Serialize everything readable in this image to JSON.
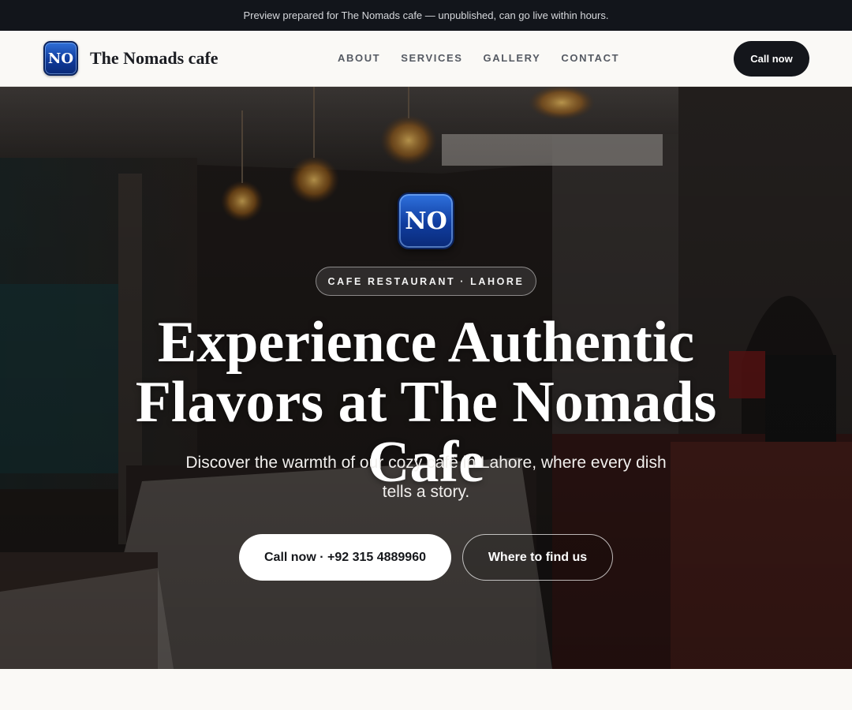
{
  "banner": {
    "text": "Preview prepared for The Nomads cafe — unpublished, can go live within hours."
  },
  "header": {
    "logo_initials": "NO",
    "brand_name": "The Nomads cafe",
    "nav": [
      {
        "label": "ABOUT"
      },
      {
        "label": "SERVICES"
      },
      {
        "label": "GALLERY"
      },
      {
        "label": "CONTACT"
      }
    ],
    "call_button": "Call now"
  },
  "hero": {
    "logo_initials": "NO",
    "tagline": "CAFE RESTAURANT · LAHORE",
    "title_line1": "Experience Authentic",
    "title_line2": "Flavors at The Nomads Cafe",
    "subtitle": "Discover the warmth of our cozy café in Lahore, where every dish tells a story.",
    "primary_button": "Call now · +92 315 4889960",
    "secondary_button": "Where to find us",
    "background_image": "cafe-restaurant-interior-photo"
  },
  "colors": {
    "banner_bg": "#12151b",
    "dark_button": "#14161b",
    "logo_blue": "#103d9f",
    "page_bg": "#faf9f6"
  }
}
